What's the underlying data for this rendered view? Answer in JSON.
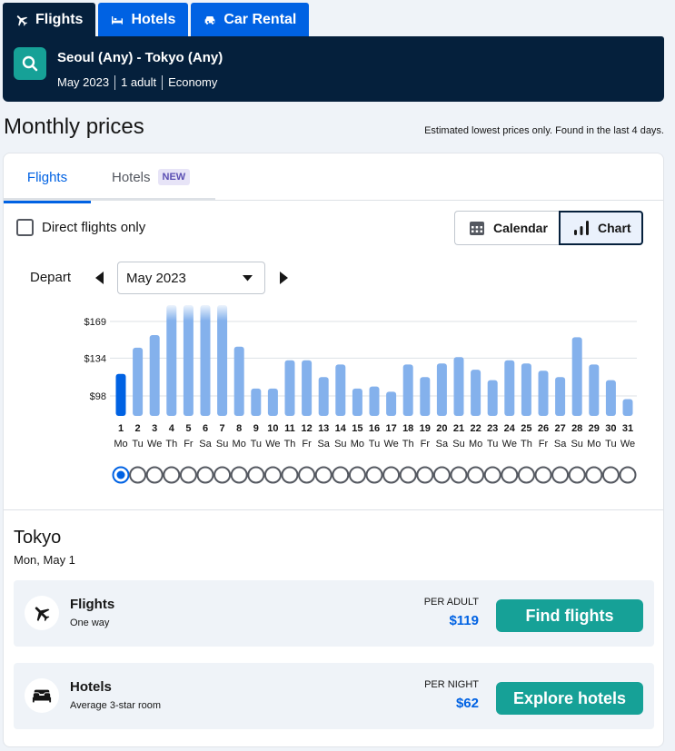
{
  "top_tabs": [
    {
      "label": "Flights",
      "icon": "plane-icon",
      "active": true
    },
    {
      "label": "Hotels",
      "icon": "bed-icon",
      "active": false
    },
    {
      "label": "Car Rental",
      "icon": "car-icon",
      "active": false
    }
  ],
  "search": {
    "route": "Seoul (Any) - Tokyo (Any)",
    "month": "May 2023",
    "travellers": "1 adult",
    "cabin": "Economy",
    "icon": "search-icon"
  },
  "page": {
    "title": "Monthly prices",
    "note": "Estimated lowest prices only. Found in the last 4 days."
  },
  "tabs": {
    "flights": "Flights",
    "hotels": "Hotels",
    "hotels_badge": "NEW"
  },
  "filters": {
    "direct_only_label": "Direct flights only",
    "direct_only_checked": false
  },
  "view_toggle": {
    "calendar": "Calendar",
    "chart": "Chart",
    "selected": "Chart"
  },
  "depart": {
    "label": "Depart",
    "month": "May 2023"
  },
  "chart_data": {
    "type": "bar",
    "y_ticks": [
      {
        "value": 169,
        "label": "$169"
      },
      {
        "value": 134,
        "label": "$134"
      },
      {
        "value": 98,
        "label": "$98"
      }
    ],
    "days": [
      "1",
      "2",
      "3",
      "4",
      "5",
      "6",
      "7",
      "8",
      "9",
      "10",
      "11",
      "12",
      "13",
      "14",
      "15",
      "16",
      "17",
      "18",
      "19",
      "20",
      "21",
      "22",
      "23",
      "24",
      "25",
      "26",
      "27",
      "28",
      "29",
      "30",
      "31"
    ],
    "weekdays": [
      "Mo",
      "Tu",
      "We",
      "Th",
      "Fr",
      "Sa",
      "Su",
      "Mo",
      "Tu",
      "We",
      "Th",
      "Fr",
      "Sa",
      "Su",
      "Mo",
      "Tu",
      "We",
      "Th",
      "Fr",
      "Sa",
      "Su",
      "Mo",
      "Tu",
      "We",
      "Th",
      "Fr",
      "Sa",
      "Su",
      "Mo",
      "Tu",
      "We"
    ],
    "values": [
      119,
      144,
      156,
      185,
      185,
      185,
      185,
      145,
      105,
      105,
      132,
      132,
      116,
      128,
      105,
      107,
      102,
      128,
      116,
      129,
      135,
      123,
      113,
      132,
      129,
      122,
      116,
      154,
      128,
      113,
      95
    ],
    "clipped": [
      false,
      false,
      false,
      true,
      true,
      true,
      true,
      false,
      false,
      false,
      false,
      false,
      false,
      false,
      false,
      false,
      false,
      false,
      false,
      false,
      false,
      false,
      false,
      false,
      false,
      false,
      false,
      false,
      false,
      false,
      false
    ],
    "selected_index": 0,
    "colors": {
      "bar": "#84b1ec",
      "selected": "#0062e3",
      "grid": "#dde1e6"
    }
  },
  "destination": {
    "city": "Tokyo",
    "date": "Mon, May 1"
  },
  "results": [
    {
      "title": "Flights",
      "subtitle": "One way",
      "price_label": "PER ADULT",
      "price": "$119",
      "cta": "Find flights",
      "icon": "plane-icon"
    },
    {
      "title": "Hotels",
      "subtitle": "Average 3-star room",
      "price_label": "PER NIGHT",
      "price": "$62",
      "cta": "Explore hotels",
      "icon": "bed-icon"
    }
  ],
  "colors": {
    "brand_dark": "#05203c",
    "brand_blue": "#0062e3",
    "cta_teal": "#16a197"
  }
}
